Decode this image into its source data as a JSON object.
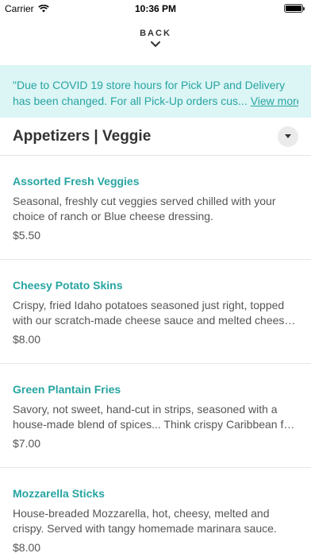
{
  "status_bar": {
    "carrier": "Carrier",
    "time": "10:36 PM"
  },
  "nav": {
    "back_label": "BACK"
  },
  "notice": {
    "line1": "\"Due to COVID 19 store hours for Pick UP and Delivery",
    "line2": "has been changed. For all Pick-Up orders cus...",
    "view_more": "View more"
  },
  "section": {
    "title": "Appetizers | Veggie"
  },
  "items": [
    {
      "name": "Assorted Fresh Veggies",
      "desc_line1": "Seasonal, freshly cut veggies served chilled with your",
      "desc_line2": "choice of ranch or Blue cheese dressing.",
      "price": "$5.50"
    },
    {
      "name": "Cheesy Potato Skins",
      "desc_line1": "Crispy, fried Idaho potatoes seasoned just right, topped",
      "desc_line2": "with our scratch-made cheese sauce and melted cheese...",
      "price": "$8.00"
    },
    {
      "name": "Green Plantain Fries",
      "desc_line1": "Savory, not sweet, hand-cut in strips, seasoned with a",
      "desc_line2": "house-made blend of spices... Think crispy Caribbean fri...",
      "price": "$7.00"
    },
    {
      "name": "Mozzarella Sticks",
      "desc_line1": "House-breaded Mozzarella, hot, cheesy, melted and",
      "desc_line2": "crispy. Served with tangy homemade marinara sauce.",
      "price": "$8.00"
    }
  ],
  "colors": {
    "accent": "#27a5a2",
    "notice_bg": "#dcf5f5"
  }
}
